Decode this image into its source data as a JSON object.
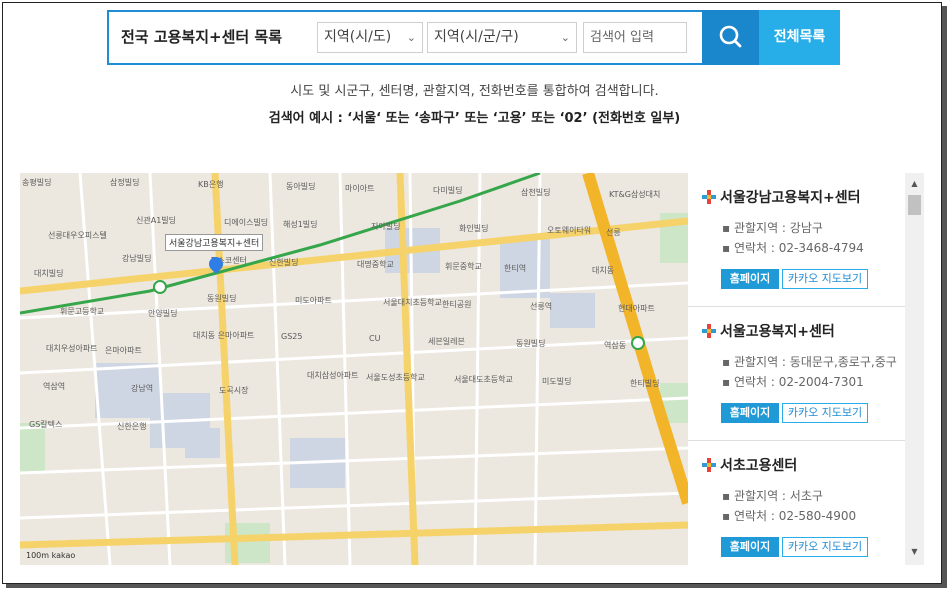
{
  "header": {
    "title": "전국 고용복지+센터 목록",
    "select_region": "지역(시/도)",
    "select_district": "지역(시/군/구)",
    "search_placeholder": "검색어 입력",
    "search_icon": "search-icon",
    "all_list_label": "전체목록",
    "accent_color": "#1a86cc",
    "secondary_color": "#27aee8"
  },
  "description": {
    "line1": "시도 및 시군구, 센터명, 관할지역, 전화번호를 통합하여 검색합니다.",
    "line2": "검색어 예시 : ‘서울‘ 또는 ‘송파구’ 또는 ‘고용’ 또는 ‘02’ (전화번호 일부)"
  },
  "map": {
    "marker_label": "서울강남고용복지+센터",
    "scale_label": "100m",
    "provider_label": "kakao",
    "labels": [
      "송평빌딩",
      "삼정빌딩",
      "KB은행",
      "동아빌딩",
      "마이아트",
      "다미빌딩",
      "삼천빌딩",
      "KT&G삼성대치",
      "선릉대우오피스텔",
      "신관A1빌딩",
      "디에이스빌딩",
      "해성1빌딩",
      "지아빌딩",
      "화인빌딩",
      "오토웨이타워",
      "선릉",
      "대치빌딩",
      "강남빌딩",
      "포스코센터",
      "신한빌딩",
      "대명중학교",
      "휘문중학교",
      "한티역",
      "대치동",
      "휘문고등학교",
      "안양빌딩",
      "동원빌딩",
      "미도아파트",
      "서울대치초등학교",
      "한티공원",
      "선릉역",
      "현대아파트",
      "대치우성아파트",
      "은마아파트",
      "대치동 은마아파트",
      "GS25",
      "CU",
      "세븐일레븐",
      "동원빌딩",
      "역삼동",
      "역삼역",
      "강남역",
      "도곡시장",
      "대치삼성아파트",
      "서울도성초등학교",
      "서울대도초등학교",
      "미도빌딩",
      "한티빌딩",
      "GS칼텍스",
      "신한은행"
    ]
  },
  "centers": [
    {
      "name": "서울강남고용복지+센터",
      "jurisdiction": "관할지역 : 강남구",
      "phone": "연락처 : 02-3468-4794",
      "homepage_label": "홈페이지",
      "kakao_label": "카카오 지도보기"
    },
    {
      "name": "서울고용복지+센터",
      "jurisdiction": "관할지역 : 동대문구,종로구,중구",
      "phone": "연락처 : 02-2004-7301",
      "homepage_label": "홈페이지",
      "kakao_label": "카카오 지도보기"
    },
    {
      "name": "서초고용센터",
      "jurisdiction": "관할지역 : 서초구",
      "phone": "연락처 : 02-580-4900",
      "homepage_label": "홈페이지",
      "kakao_label": "카카오 지도보기"
    }
  ]
}
